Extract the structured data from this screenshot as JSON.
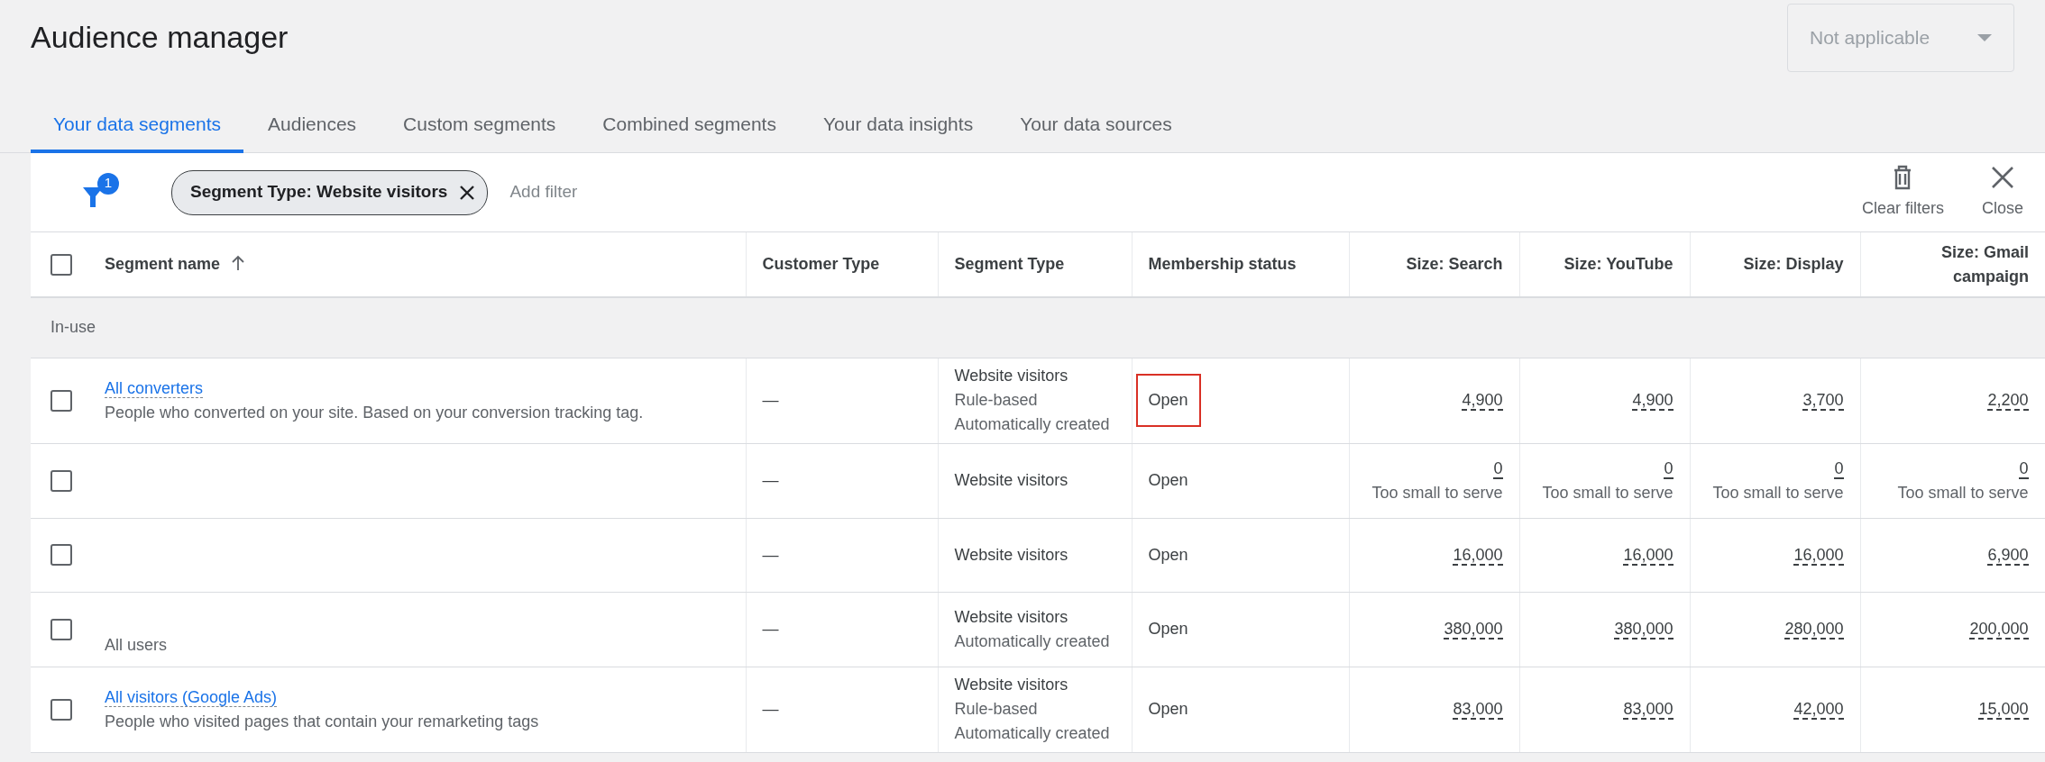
{
  "page_title": "Audience manager",
  "account_select": {
    "value": "Not applicable",
    "disabled": true
  },
  "tabs": [
    {
      "label": "Your data segments",
      "selected": true
    },
    {
      "label": "Audiences",
      "selected": false
    },
    {
      "label": "Custom segments",
      "selected": false
    },
    {
      "label": "Combined segments",
      "selected": false
    },
    {
      "label": "Your data insights",
      "selected": false
    },
    {
      "label": "Your data sources",
      "selected": false
    }
  ],
  "filter_bar": {
    "filter_count": "1",
    "chips": [
      {
        "label": "Segment Type: Website visitors"
      }
    ],
    "add_filter": "Add filter",
    "actions": [
      {
        "kind": "clear",
        "label": "Clear filters"
      },
      {
        "kind": "close",
        "label": "Close"
      }
    ]
  },
  "table": {
    "select_all_checked": false,
    "columns": [
      {
        "label": "Segment name",
        "sorted": true,
        "kind": "text"
      },
      {
        "label": "Customer Type",
        "sorted": false,
        "kind": "text"
      },
      {
        "label": "Segment Type",
        "sorted": false,
        "kind": "text"
      },
      {
        "label": "Membership status",
        "sorted": false,
        "kind": "text"
      },
      {
        "label": "Size: Search",
        "sorted": false,
        "kind": "number"
      },
      {
        "label": "Size: YouTube",
        "sorted": false,
        "kind": "number"
      },
      {
        "label": "Size: Display",
        "sorted": false,
        "kind": "number"
      },
      {
        "label": "Size: Gmail campaign",
        "sorted": false,
        "kind": "number"
      }
    ],
    "group": "In-use",
    "rows": [
      {
        "checked": false,
        "kind": "link",
        "name": "All converters",
        "description": "People who converted on your site. Based on your conversion tracking tag.",
        "customer_type": "—",
        "segment_type": [
          "Website visitors",
          "Rule-based",
          "Automatically created"
        ],
        "membership": "Open",
        "highlighted": true,
        "sizes": [
          {
            "value": "4,900"
          },
          {
            "value": "4,900"
          },
          {
            "value": "3,700"
          },
          {
            "value": "2,200"
          }
        ]
      },
      {
        "checked": false,
        "kind": "hidden",
        "customer_type": "—",
        "segment_type": [
          "Website visitors"
        ],
        "membership": "Open",
        "highlighted": false,
        "sizes": [
          {
            "value": "0",
            "note": "Too small to serve"
          },
          {
            "value": "0",
            "note": "Too small to serve"
          },
          {
            "value": "0",
            "note": "Too small to serve"
          },
          {
            "value": "0",
            "note": "Too small to serve"
          }
        ]
      },
      {
        "checked": false,
        "kind": "hidden",
        "customer_type": "—",
        "segment_type": [
          "Website visitors"
        ],
        "membership": "Open",
        "highlighted": false,
        "sizes": [
          {
            "value": "16,000"
          },
          {
            "value": "16,000"
          },
          {
            "value": "16,000"
          },
          {
            "value": "6,900"
          }
        ]
      },
      {
        "checked": false,
        "kind": "plain",
        "name": "All users",
        "customer_type": "—",
        "segment_type": [
          "Website visitors",
          "Automatically created"
        ],
        "membership": "Open",
        "highlighted": false,
        "sizes": [
          {
            "value": "380,000"
          },
          {
            "value": "380,000"
          },
          {
            "value": "280,000"
          },
          {
            "value": "200,000"
          }
        ]
      },
      {
        "checked": false,
        "kind": "link",
        "name": "All visitors (Google Ads)",
        "description": "People who visited pages that contain your remarketing tags",
        "customer_type": "—",
        "segment_type": [
          "Website visitors",
          "Rule-based",
          "Automatically created"
        ],
        "membership": "Open",
        "highlighted": false,
        "sizes": [
          {
            "value": "83,000"
          },
          {
            "value": "83,000"
          },
          {
            "value": "42,000"
          },
          {
            "value": "15,000"
          }
        ]
      }
    ]
  }
}
